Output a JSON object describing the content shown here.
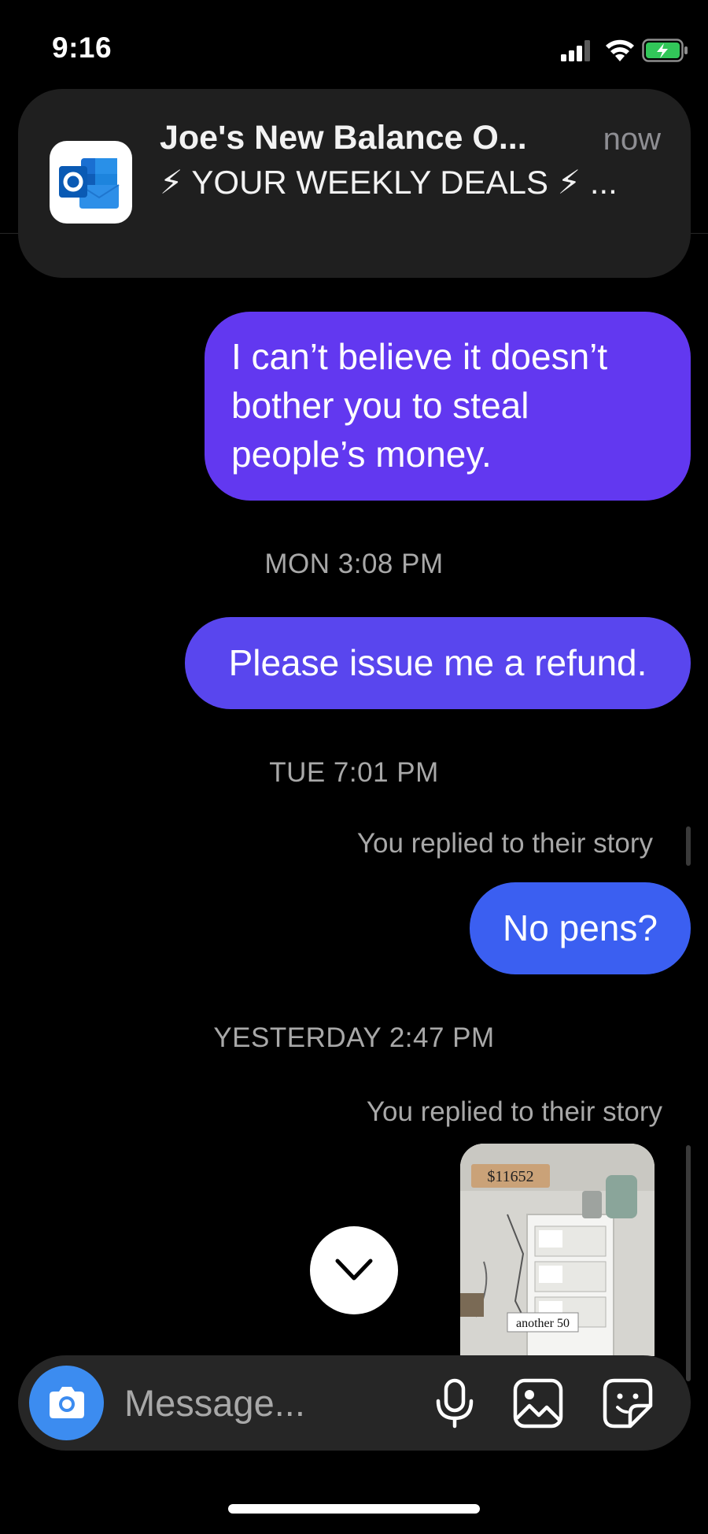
{
  "status_bar": {
    "time": "9:16"
  },
  "notification": {
    "app_icon": "outlook-icon",
    "title": "Joe's New Balance O...",
    "time": "now",
    "body": "⚡ YOUR WEEKLY DEALS ⚡ ..."
  },
  "messages": [
    {
      "type": "sent",
      "text": "I can’t believe it doesn’t bother you to steal people’s money."
    },
    {
      "type": "timestamp",
      "text": "MON 3:08 PM"
    },
    {
      "type": "sent",
      "text": "Please issue me a refund."
    },
    {
      "type": "timestamp",
      "text": "TUE 7:01 PM"
    },
    {
      "type": "story_reply_label",
      "text": "You replied to their story"
    },
    {
      "type": "sent",
      "text": "No pens?"
    },
    {
      "type": "timestamp",
      "text": "YESTERDAY 2:47 PM"
    },
    {
      "type": "story_reply_label",
      "text": "You replied to their story"
    },
    {
      "type": "story_thumbnail",
      "caption": "another 50",
      "counter": "$11652"
    }
  ],
  "scroll_button_icon": "chevron-down-icon",
  "composer": {
    "placeholder": "Message...",
    "camera_icon": "camera-icon",
    "mic_icon": "microphone-icon",
    "gallery_icon": "image-icon",
    "sticker_icon": "sticker-icon"
  },
  "colors": {
    "bubble_1": "#6238f0",
    "bubble_2": "#5946ee",
    "bubble_3": "#3b5ff1",
    "camera_button": "#3c8cf0",
    "background": "#000000"
  }
}
